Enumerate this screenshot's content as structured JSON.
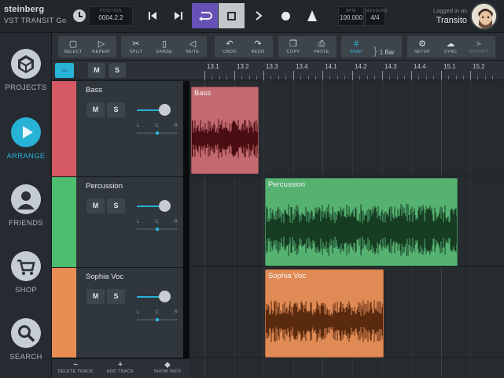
{
  "brand": {
    "name": "steinberg",
    "product": "VST TRANSIT Go"
  },
  "transport": {
    "position_caption": "POSITION",
    "position": "0004.2.2",
    "bpm_caption": "BPM",
    "bpm": "100.000",
    "signature_caption": "MEASURE",
    "signature": "4/4"
  },
  "account": {
    "logged_in_label": "Logged in as",
    "username": "Transito"
  },
  "nav": [
    {
      "label": "PROJECTS",
      "icon": "projects-cube-icon"
    },
    {
      "label": "ARRANGE",
      "icon": "play-icon",
      "active": true
    },
    {
      "label": "FRIENDS",
      "icon": "person-icon"
    },
    {
      "label": "SHOP",
      "icon": "cart-icon"
    },
    {
      "label": "SEARCH",
      "icon": "magnifier-icon"
    }
  ],
  "tools": {
    "select": "SELECT",
    "repeat": "REPEAT",
    "split": "SPLIT",
    "erase": "ERASE",
    "mute": "MUTE",
    "undo": "UNDO",
    "redo": "REDO",
    "copy": "COPY",
    "paste": "PASTE",
    "snap": "SNAP",
    "snap_value": "1 Bar",
    "setup": "SETUP",
    "sync": "SYNC",
    "export": "EXPORT"
  },
  "header": {
    "mute": "M",
    "solo": "S"
  },
  "ruler": {
    "labels": [
      "13.1",
      "13.2",
      "13.3",
      "13.4",
      "14.1",
      "14.2",
      "14.3",
      "14.4",
      "15.1",
      "15.2"
    ]
  },
  "tracks": [
    {
      "name": "Bass",
      "mute": "M",
      "solo": "S",
      "pan": [
        "L",
        "C",
        "R"
      ],
      "color": "#d55a64"
    },
    {
      "name": "Percussion",
      "mute": "M",
      "solo": "S",
      "pan": [
        "L",
        "C",
        "R"
      ],
      "color": "#4dbe6f"
    },
    {
      "name": "Sophia Voc",
      "mute": "M",
      "solo": "S",
      "pan": [
        "L",
        "C",
        "R"
      ],
      "color": "#e98d55"
    }
  ],
  "events": [
    {
      "title": "Bass",
      "color": "#c26a70",
      "wave": "#4a0d12"
    },
    {
      "title": "Percussion",
      "color": "#56b271",
      "wave": "#163c22"
    },
    {
      "title": "Sophia Voc",
      "color": "#e08b55",
      "wave": "#5a2a0e"
    }
  ],
  "bottom": {
    "delete": "DELETE TRACK",
    "add": "ADD TRACK",
    "info": "SHOW INFO"
  }
}
